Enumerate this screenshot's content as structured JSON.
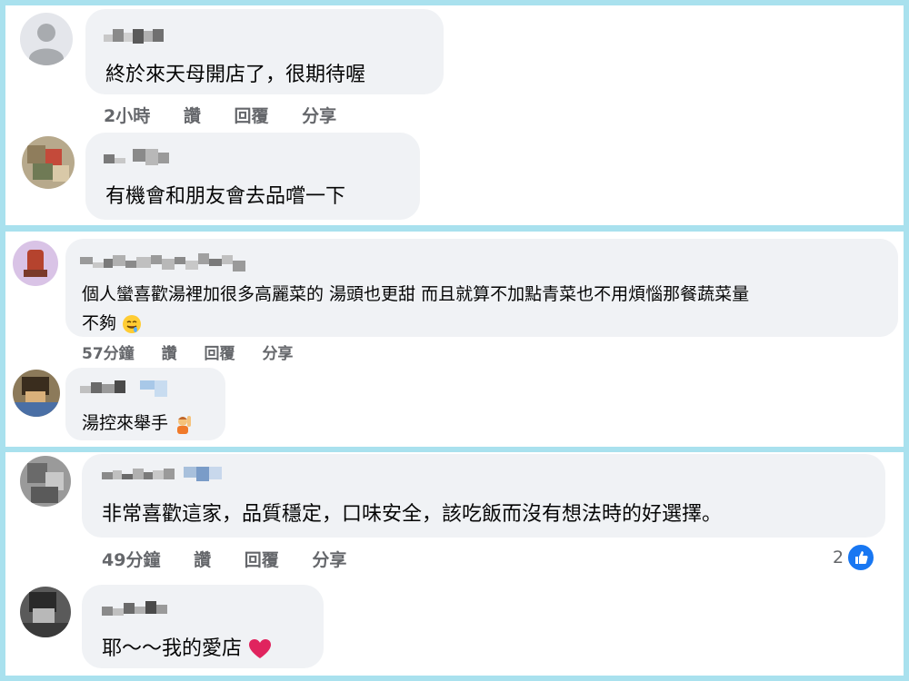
{
  "colors": {
    "divider": "#a9e1ee",
    "bubble": "#f0f2f5",
    "meta": "#65676b",
    "like": "#1877f2",
    "heart": "#e0245e"
  },
  "panel1": {
    "comment1": {
      "name": "",
      "text": "終於來天母開店了，很期待喔",
      "actions": {
        "time": "2小時",
        "like": "讚",
        "reply": "回覆",
        "share": "分享"
      },
      "avatar_icon": "default-user-icon"
    },
    "comment2": {
      "name": "",
      "text": "有機會和朋友會去品嚐一下"
    }
  },
  "panel2": {
    "comment1": {
      "name": "",
      "text_line1": "個人蠻喜歡湯裡加很多高麗菜的 湯頭也更甜 而且就算不加點青菜也不用煩惱那餐蔬菜量",
      "text_line2": "不夠",
      "emoji": "drooling-face-emoji",
      "actions": {
        "time": "57分鐘",
        "like": "讚",
        "reply": "回覆",
        "share": "分享"
      }
    },
    "comment2": {
      "name": "",
      "text": "湯控來舉手",
      "emoji": "person-raising-hand-emoji"
    }
  },
  "panel3": {
    "comment1": {
      "name": "",
      "text": "非常喜歡這家，品質穩定，口味安全，該吃飯而沒有想法時的好選擇。",
      "actions": {
        "time": "49分鐘",
        "like": "讚",
        "reply": "回覆",
        "share": "分享"
      },
      "reaction_count": "2",
      "reaction_icon": "like-icon"
    },
    "comment2": {
      "name": "",
      "text": "耶～～我的愛店",
      "emoji": "red-heart-emoji"
    }
  }
}
